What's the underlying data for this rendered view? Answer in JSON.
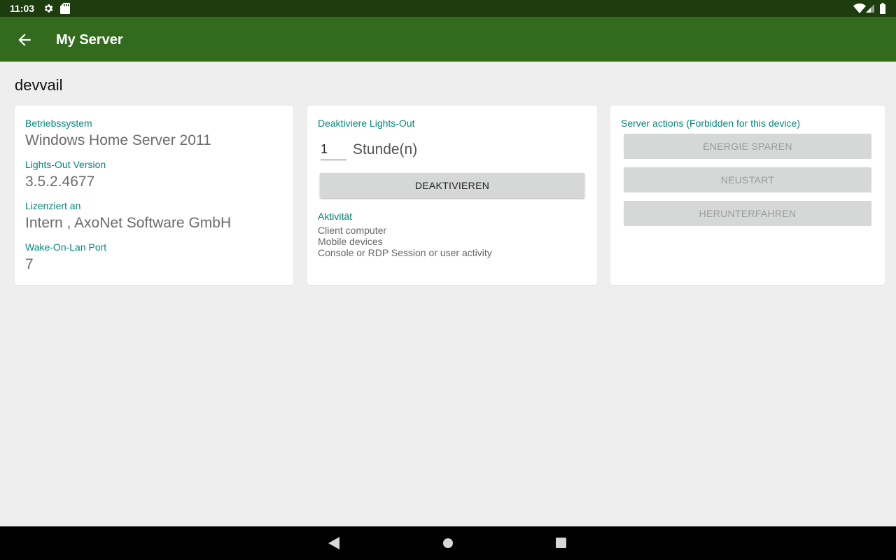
{
  "status_bar": {
    "time": "11:03",
    "icons": [
      "settings-icon",
      "sd-card-icon",
      "wifi-icon",
      "signal-icon",
      "battery-icon"
    ]
  },
  "app_bar": {
    "title": "My Server",
    "background": "#336b1e"
  },
  "server_name": "devvail",
  "info": {
    "os_label": "Betriebssystem",
    "os_value": "Windows Home Server 2011",
    "version_label": "Lights-Out Version",
    "version_value": "3.5.2.4677",
    "license_label": "Lizenziert an",
    "license_value": "Intern , AxoNet Software GmbH",
    "wol_label": "Wake-On-Lan Port",
    "wol_value": "7"
  },
  "lights_out": {
    "title": "Deaktiviere Lights-Out",
    "hours_value": "1",
    "hours_unit": "Stunde(n)",
    "deactivate_label": "DEAKTIVIEREN",
    "activity_label": "Aktivität",
    "activities": [
      "Client computer",
      "Mobile devices",
      "Console or RDP Session or user activity"
    ]
  },
  "actions": {
    "title": "Server actions (Forbidden for this device)",
    "buttons": [
      "ENERGIE SPAREN",
      "NEUSTART",
      "HERUNTERFAHREN"
    ]
  },
  "colors": {
    "accent": "#00877a",
    "status_bar": "#1e3d0f",
    "background": "#eeeeee"
  }
}
